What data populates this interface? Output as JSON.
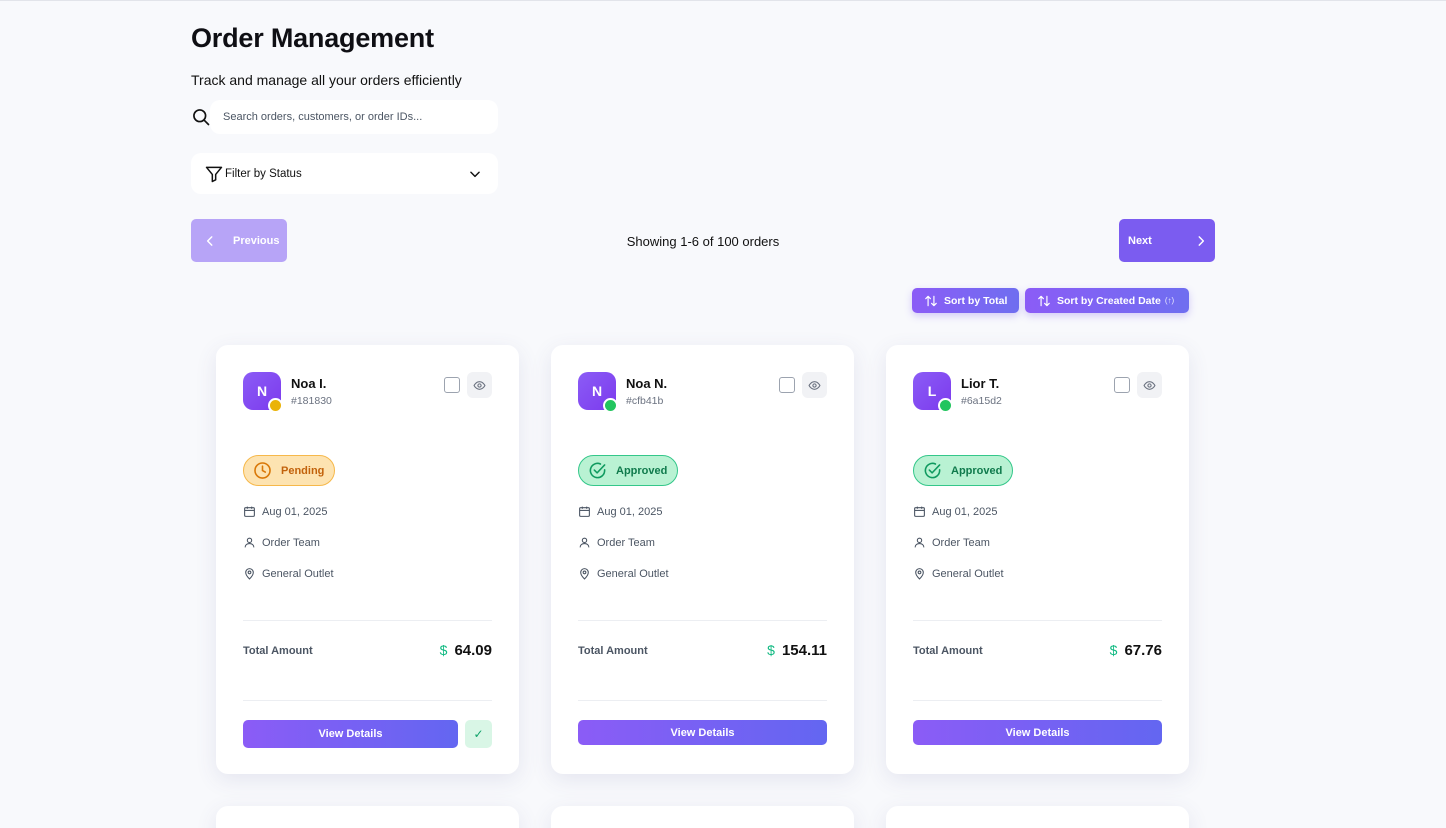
{
  "header": {
    "title": "Order Management",
    "subtitle": "Track and manage all your orders efficiently"
  },
  "search": {
    "placeholder": "Search orders, customers, or order IDs...",
    "value": ""
  },
  "filter": {
    "label": "Filter by Status"
  },
  "pagination": {
    "previous_label": "Previous",
    "next_label": "Next",
    "showing_text": "Showing 1-6 of 100 orders",
    "previous_disabled": true
  },
  "sort": {
    "total_label": "Sort by Total",
    "date_label": "Sort by Created Date",
    "date_direction": "(↑)"
  },
  "colors": {
    "accent": "#7b5cf0",
    "pending": "#f59e0b",
    "approved": "#22c55e"
  },
  "orders": [
    {
      "initial": "N",
      "name": "Noa I.",
      "id": "#181830",
      "status": "Pending",
      "status_icon": "clock-icon",
      "date": "Aug 01, 2025",
      "team": "Order Team",
      "outlet": "General Outlet",
      "total_label": "Total Amount",
      "currency": "$",
      "amount": "64.09",
      "view_label": "View Details",
      "approve_glyph": "✓"
    },
    {
      "initial": "N",
      "name": "Noa N.",
      "id": "#cfb41b",
      "status": "Approved",
      "status_icon": "check-circle-icon",
      "date": "Aug 01, 2025",
      "team": "Order Team",
      "outlet": "General Outlet",
      "total_label": "Total Amount",
      "currency": "$",
      "amount": "154.11",
      "view_label": "View Details"
    },
    {
      "initial": "L",
      "name": "Lior T.",
      "id": "#6a15d2",
      "status": "Approved",
      "status_icon": "check-circle-icon",
      "date": "Aug 01, 2025",
      "team": "Order Team",
      "outlet": "General Outlet",
      "total_label": "Total Amount",
      "currency": "$",
      "amount": "67.76",
      "view_label": "View Details"
    }
  ]
}
